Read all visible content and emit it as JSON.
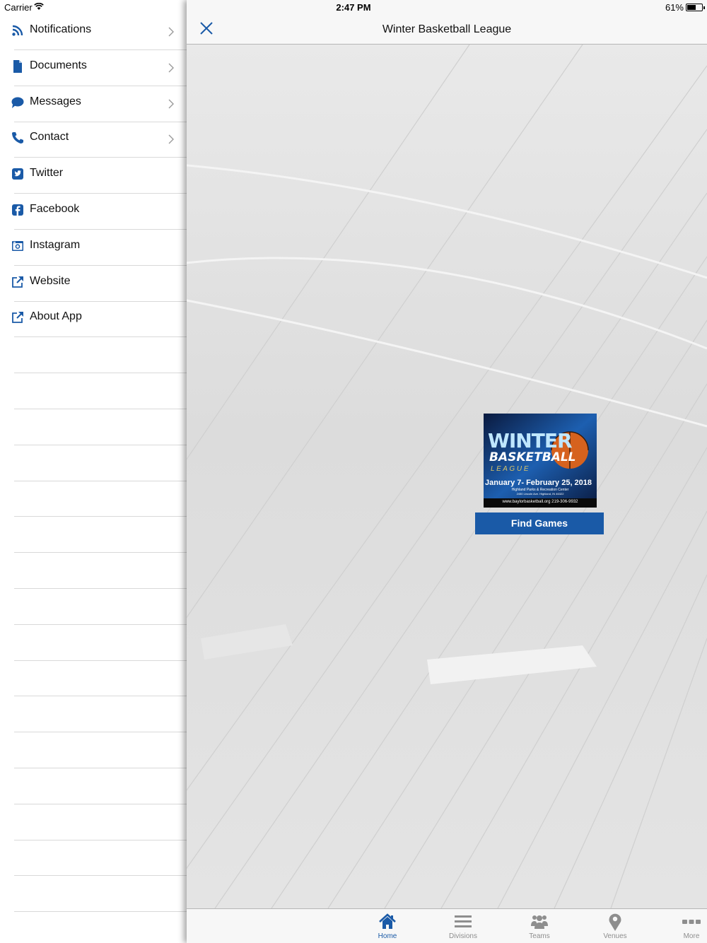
{
  "status_bar": {
    "carrier": "Carrier",
    "time": "2:47 PM",
    "battery": "61%",
    "battery_level": 0.61
  },
  "side_menu": {
    "items": [
      {
        "label": "Notifications",
        "icon": "rss-icon",
        "chevron": true
      },
      {
        "label": "Documents",
        "icon": "document-icon",
        "chevron": true
      },
      {
        "label": "Messages",
        "icon": "chat-bubble-icon",
        "chevron": true
      },
      {
        "label": "Contact",
        "icon": "phone-icon",
        "chevron": true
      },
      {
        "label": "Twitter",
        "icon": "twitter-icon",
        "chevron": false
      },
      {
        "label": "Facebook",
        "icon": "facebook-icon",
        "chevron": false
      },
      {
        "label": "Instagram",
        "icon": "instagram-icon",
        "chevron": false
      },
      {
        "label": "Website",
        "icon": "external-link-icon",
        "chevron": false
      },
      {
        "label": "About App",
        "icon": "external-link-icon",
        "chevron": false
      }
    ],
    "empty_rows": 16
  },
  "header": {
    "title": "Winter Basketball League",
    "close_icon": "close-icon"
  },
  "promo": {
    "title_line1": "WINTER",
    "title_line2": "BASKETBALL",
    "title_line3": "L E A G U E",
    "dates": "January 7- February 25, 2018",
    "venue": "Highland Parks & Recreation Center",
    "address": "2450 Lincoln Ave. Highland, IN 46322",
    "footer": "www.baylorbasketball.org 219-306-9932"
  },
  "find_games_label": "Find Games",
  "tabs": [
    {
      "label": "Home",
      "icon": "home-icon",
      "active": true
    },
    {
      "label": "Divisions",
      "icon": "list-icon",
      "active": false
    },
    {
      "label": "Teams",
      "icon": "people-icon",
      "active": false
    },
    {
      "label": "Venues",
      "icon": "map-pin-icon",
      "active": false
    },
    {
      "label": "More",
      "icon": "more-icon",
      "active": false
    }
  ],
  "colors": {
    "accent": "#1a5aa7",
    "tab_inactive": "#8e8e8e",
    "separator": "#d9d9d9"
  }
}
